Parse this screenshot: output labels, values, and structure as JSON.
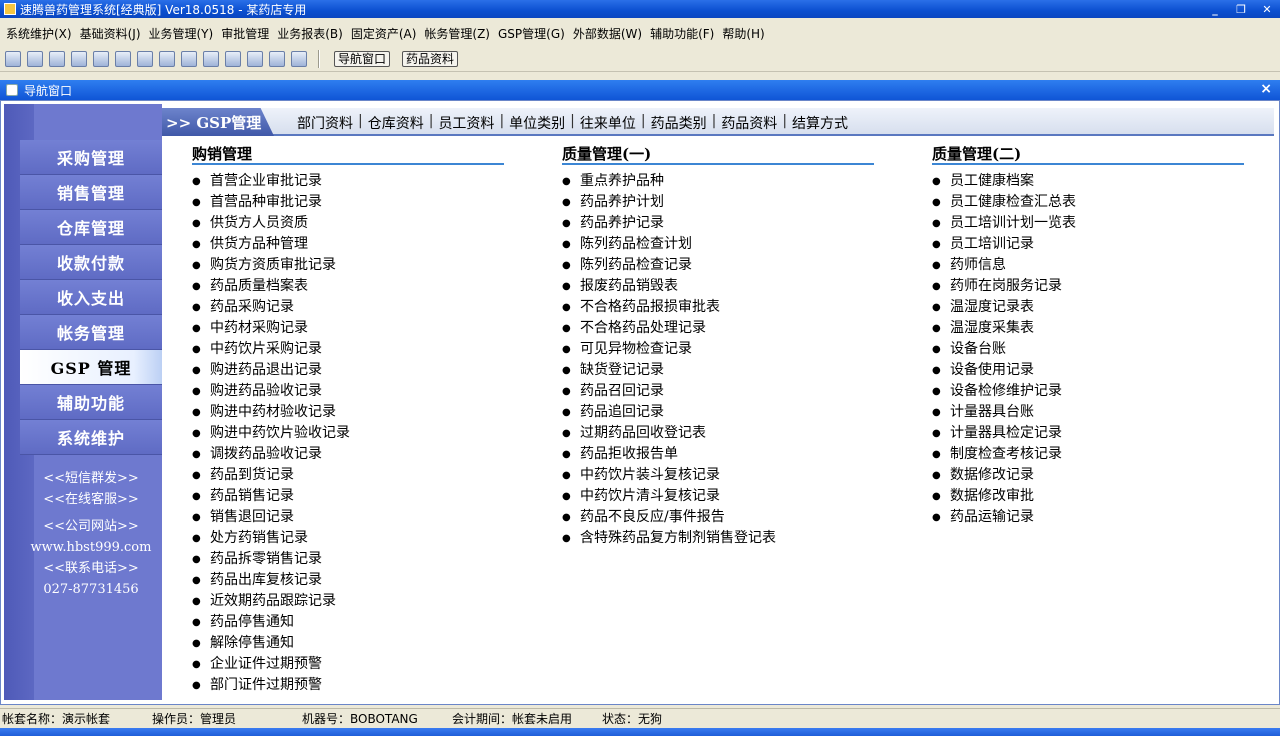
{
  "window": {
    "title": "速腾兽药管理系统[经典版] Ver18.0518  -  某药店专用"
  },
  "menubar": [
    "系统维护(X)",
    "基础资料(J)",
    "业务管理(Y)",
    "审批管理",
    "业务报表(B)",
    "固定资产(A)",
    "帐务管理(Z)",
    "GSP管理(G)",
    "外部数据(W)",
    "辅助功能(F)",
    "帮助(H)"
  ],
  "toolbar": {
    "icons": [
      "list-icon",
      "grid-icon",
      "window-icon",
      "chat-icon",
      "mail-icon",
      "puzzle-icon",
      "people-icon",
      "folder-icon",
      "export-icon",
      "monitor-icon",
      "save-icon",
      "print-icon",
      "help-icon",
      "exit-icon"
    ],
    "nav_window_label": "导航窗口",
    "drug_data_label": "药品资料"
  },
  "nav_window": {
    "title": "导航窗口",
    "close": "×"
  },
  "sidebar": {
    "items": [
      {
        "label": "采购管理"
      },
      {
        "label": "销售管理"
      },
      {
        "label": "仓库管理"
      },
      {
        "label": "收款付款"
      },
      {
        "label": "收入支出"
      },
      {
        "label": "帐务管理"
      },
      {
        "label": "GSP 管理"
      },
      {
        "label": "辅助功能"
      },
      {
        "label": "系统维护"
      }
    ],
    "active_index": 6,
    "links": {
      "sms": "<<短信群发>>",
      "support": "<<在线客服>>",
      "website": "<<公司网站>>",
      "url": "www.hbst999.com",
      "phone_label": "<<联系电话>>",
      "phone": "027-87731456"
    }
  },
  "tabbar": {
    "head": ">> GSP管理",
    "links": [
      "部门资料",
      "仓库资料",
      "员工资料",
      "单位类别",
      "往来单位",
      "药品类别",
      "药品资料",
      "结算方式"
    ]
  },
  "columns": [
    {
      "title": "购销管理",
      "items": [
        "首营企业审批记录",
        "首营品种审批记录",
        "供货方人员资质",
        "供货方品种管理",
        "购货方资质审批记录",
        "药品质量档案表",
        "药品采购记录",
        "中药材采购记录",
        "中药饮片采购记录",
        "购进药品退出记录",
        "购进药品验收记录",
        "购进中药材验收记录",
        "购进中药饮片验收记录",
        "调拨药品验收记录",
        "药品到货记录",
        "药品销售记录",
        "销售退回记录",
        "处方药销售记录",
        "药品拆零销售记录",
        "药品出库复核记录",
        "近效期药品跟踪记录",
        "药品停售通知",
        "解除停售通知",
        "企业证件过期预警",
        "部门证件过期预警"
      ]
    },
    {
      "title": "质量管理(一)",
      "items": [
        "重点养护品种",
        "药品养护计划",
        "药品养护记录",
        "陈列药品检查计划",
        "陈列药品检查记录",
        "报废药品销毁表",
        "不合格药品报损审批表",
        "不合格药品处理记录",
        "可见异物检查记录",
        "缺货登记记录",
        "药品召回记录",
        "药品追回记录",
        "过期药品回收登记表",
        "药品拒收报告单",
        "中药饮片装斗复核记录",
        "中药饮片清斗复核记录",
        "药品不良反应/事件报告",
        "含特殊药品复方制剂销售登记表"
      ]
    },
    {
      "title": "质量管理(二)",
      "items": [
        "员工健康档案",
        "员工健康检查汇总表",
        "员工培训计划一览表",
        "员工培训记录",
        "药师信息",
        "药师在岗服务记录",
        "温湿度记录表",
        "温湿度采集表",
        "设备台账",
        "设备使用记录",
        "设备检修维护记录",
        "计量器具台账",
        "计量器具检定记录",
        "制度检查考核记录",
        "数据修改记录",
        "数据修改审批",
        "药品运输记录"
      ]
    }
  ],
  "statusbar": {
    "account": "帐套名称：演示帐套",
    "operator": "操作员：管理员",
    "machine": "机器号：BOBOTANG",
    "period": "会计期间：帐套未启用",
    "state": "状态：无狗"
  },
  "colors": {
    "title_blue": "#0b4fd0",
    "sidebar": "#6e79cf",
    "divider": "#3c86d4"
  }
}
